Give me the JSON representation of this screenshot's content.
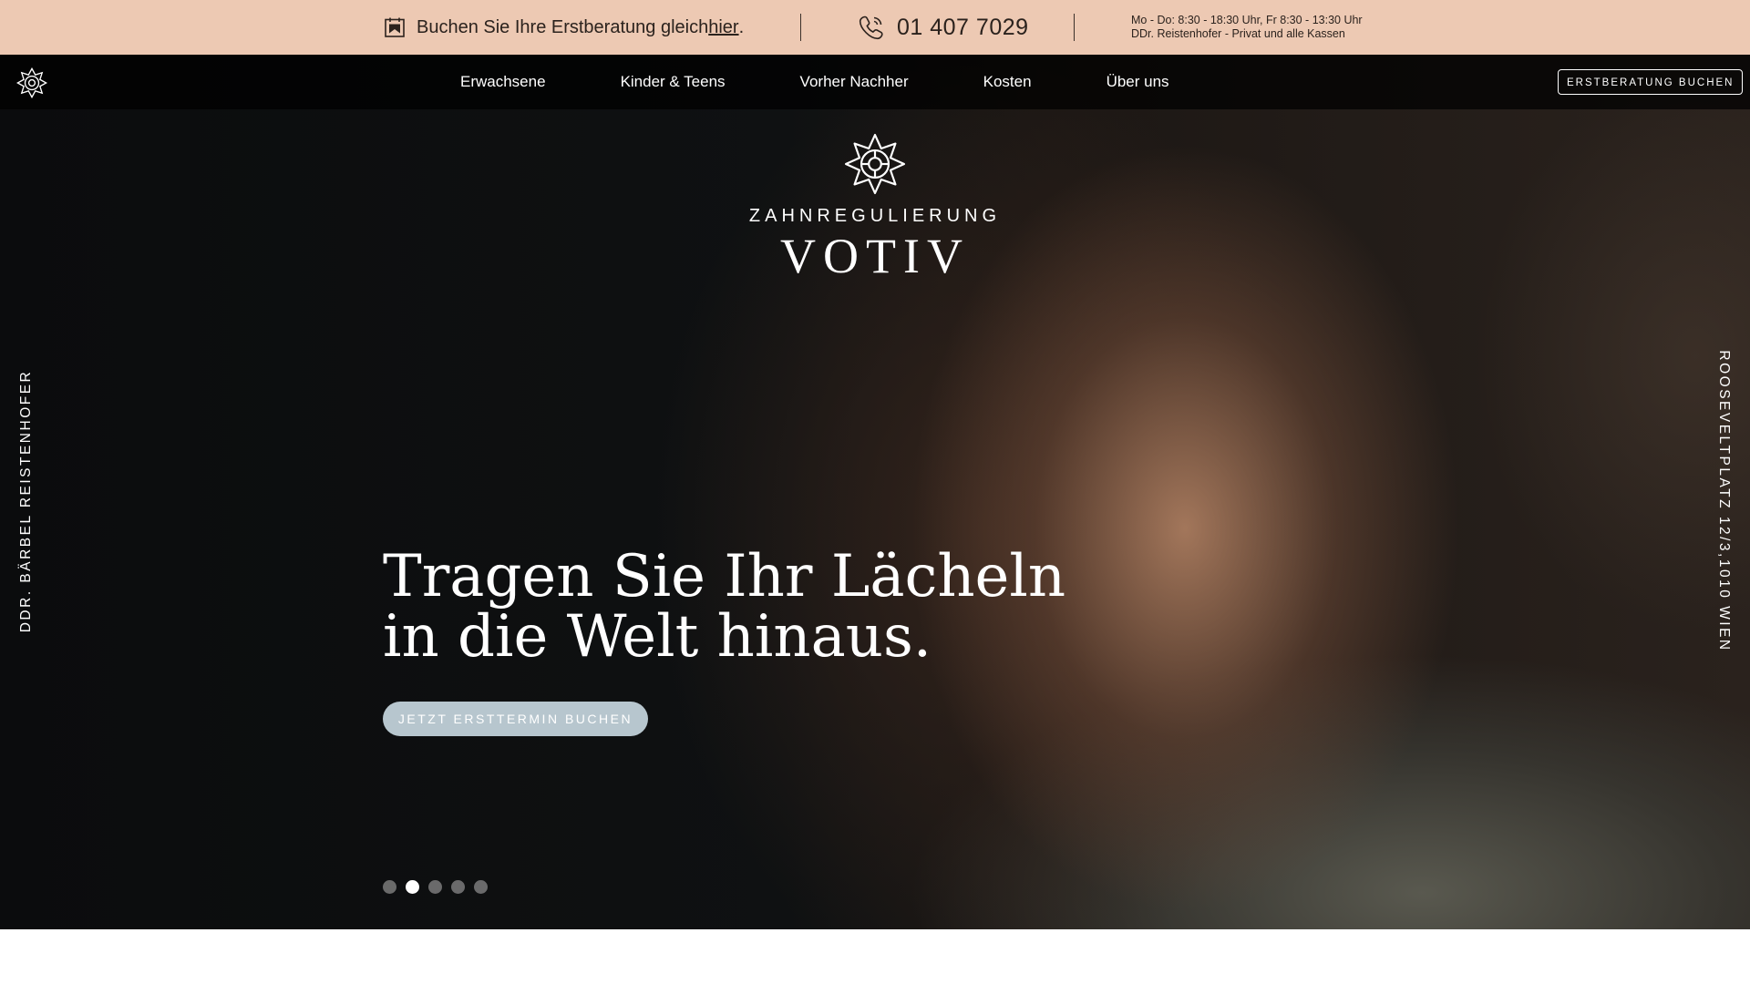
{
  "topbar": {
    "booking_text": "Buchen Sie Ihre Erstberatung gleich ",
    "booking_link": "hier",
    "booking_period": ".",
    "phone": "01 407 7029",
    "hours": "Mo - Do: 8:30 - 18:30 Uhr, Fr 8:30 - 13:30 Uhr",
    "doctor_info": "DDr. Reistenhofer - Privat und alle Kassen"
  },
  "nav": {
    "items": [
      "Erwachsene",
      "Kinder & Teens",
      "Vorher Nachher",
      "Kosten",
      "Über uns"
    ],
    "cta": "ERSTBERATUNG BUCHEN"
  },
  "hero": {
    "brand_top": "ZAHNREGULIERUNG",
    "brand_name": "VOTIV",
    "side_left": "DDR. BÄRBEL REISTENHOFER",
    "side_right": "ROOSEVELTPLATZ 12/3,1010 WIEN",
    "headline_line1": "Tragen Sie Ihr Lächeln",
    "headline_line2": "in die Welt hinaus.",
    "cta": "JETZT ERSTTERMIN BUCHEN",
    "slider": {
      "total": 5,
      "active": 2
    }
  },
  "colors": {
    "topbar_bg": "#edc9b3",
    "cta_bg": "#b7c6ce",
    "nav_bg": "#000000"
  }
}
